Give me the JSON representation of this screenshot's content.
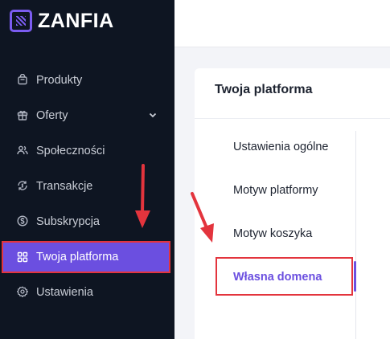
{
  "app": {
    "logo_text": "ZANFIA",
    "accent": "#6b4fe0",
    "highlight": "#e3343d"
  },
  "sidebar": {
    "items": [
      {
        "label": "Produkty",
        "icon": "bag-icon"
      },
      {
        "label": "Oferty",
        "icon": "gift-icon",
        "expandable": true
      },
      {
        "label": "Społeczności",
        "icon": "users-icon"
      },
      {
        "label": "Transakcje",
        "icon": "exchange-icon"
      },
      {
        "label": "Subskrypcja",
        "icon": "dollar-icon"
      },
      {
        "label": "Twoja platforma",
        "icon": "grid-icon",
        "active": true
      },
      {
        "label": "Ustawienia",
        "icon": "settings-icon"
      }
    ]
  },
  "panel": {
    "title": "Twoja platforma",
    "menu": [
      {
        "label": "Ustawienia ogólne"
      },
      {
        "label": "Motyw platformy"
      },
      {
        "label": "Motyw koszyka"
      },
      {
        "label": "Własna domena",
        "active": true
      }
    ]
  }
}
